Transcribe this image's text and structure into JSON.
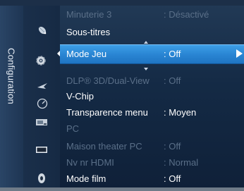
{
  "sidebar": {
    "title": "Configuration"
  },
  "icons": [
    "satellite-dish-icon",
    "gear-icon",
    "bird-icon",
    "dial-icon",
    "tv-icon",
    "tv-icon",
    "disc-icon"
  ],
  "menu": {
    "items": [
      {
        "label": "Minuterie 3",
        "value": ": Désactivé",
        "state": "dim"
      },
      {
        "label": "Sous-titres",
        "value": "",
        "state": "bright"
      },
      {
        "label": "Mode Jeu",
        "value": ": Off",
        "state": "selected"
      },
      {
        "label": "DLP® 3D/Dual-View",
        "value": ": Off",
        "state": "dim"
      },
      {
        "label": "V-Chip",
        "value": "",
        "state": "bright"
      },
      {
        "label": "Transparence menu",
        "value": ": Moyen",
        "state": "bright"
      },
      {
        "label": "PC",
        "value": "",
        "state": "dim"
      },
      {
        "label": "Maison theater PC",
        "value": ": Off",
        "state": "dim"
      },
      {
        "label": "Nv nr HDMI",
        "value": ": Normal",
        "state": "dim"
      },
      {
        "label": "Mode film",
        "value": ": Off",
        "state": "bright"
      }
    ]
  }
}
